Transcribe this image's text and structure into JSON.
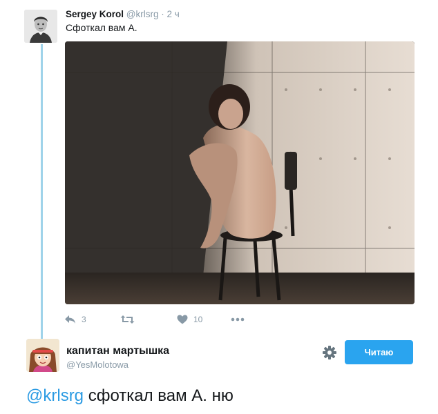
{
  "tweet": {
    "author_name": "Sergey Korol",
    "author_handle": "@krlsrg",
    "separator": "·",
    "time": "2 ч",
    "text": "Сфоткал вам А.",
    "image_alt": "photo",
    "actions": [
      {
        "icon": "reply-icon",
        "count": "3"
      },
      {
        "icon": "retweet-icon",
        "count": ""
      },
      {
        "icon": "heart-icon",
        "count": "10"
      },
      {
        "icon": "more-icon",
        "count": ""
      }
    ]
  },
  "user_card": {
    "name": "капитан мартышка",
    "handle": "@YesMolotowa",
    "settings_icon": "gear-icon",
    "follow_label": "Читаю"
  },
  "comment": {
    "mention": "@krlsrg",
    "text": " сфоткал вам А. ню"
  },
  "colors": {
    "accent": "#2aa4ef",
    "link": "#2b9be3",
    "thread_line": "#9fd3ea",
    "muted": "#8899a6"
  }
}
